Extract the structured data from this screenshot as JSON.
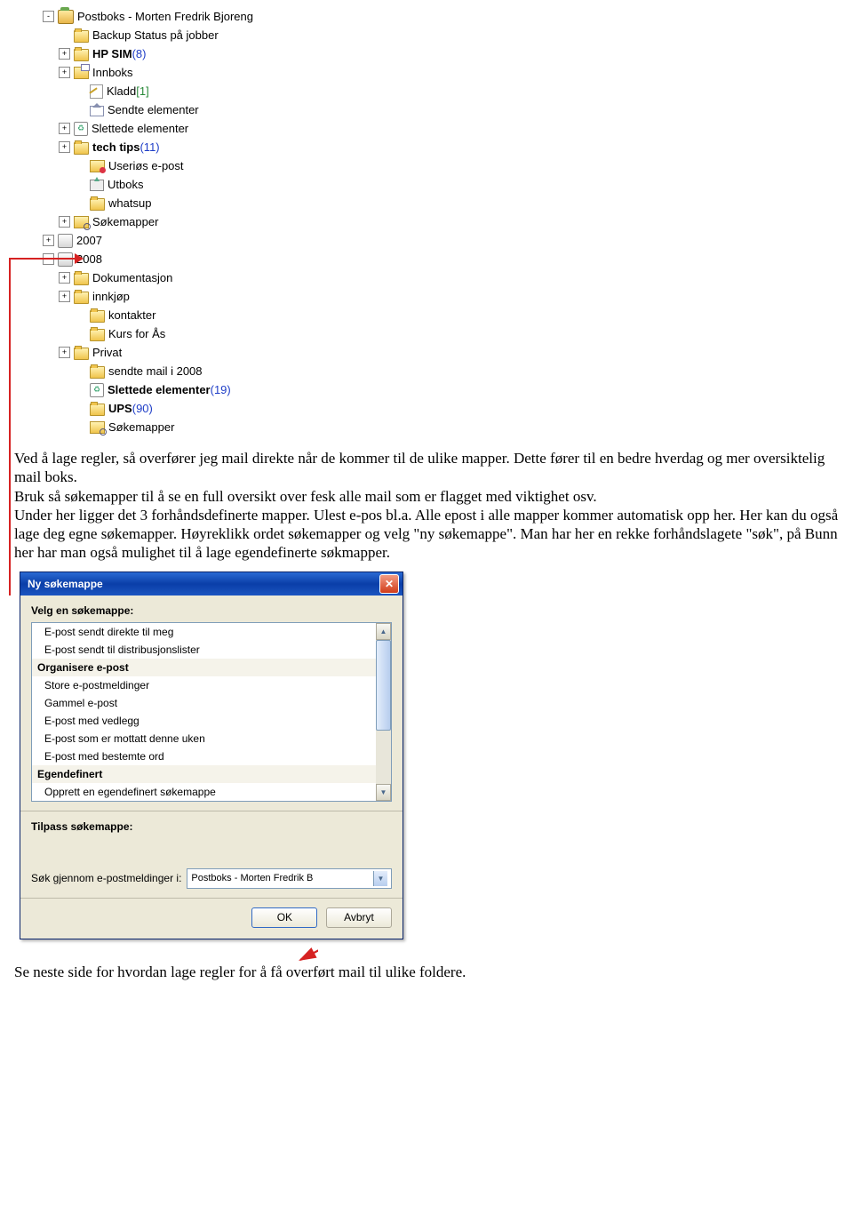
{
  "tree": {
    "root": {
      "label": "Postboks - Morten Fredrik Bjoreng"
    },
    "items1": [
      {
        "label": "Backup Status på jobber",
        "icon": "folder",
        "exp": "",
        "ind": 1
      },
      {
        "label": "HP SIM",
        "count": "(8)",
        "countClass": "count-blue",
        "bold": true,
        "icon": "folder",
        "exp": "+",
        "ind": 1
      },
      {
        "label": "Innboks",
        "icon": "inbox",
        "exp": "+",
        "ind": 1
      },
      {
        "label": "Kladd",
        "count": "[1]",
        "countClass": "count-green",
        "icon": "draft",
        "exp": "",
        "ind": 2
      },
      {
        "label": "Sendte elementer",
        "icon": "sent",
        "exp": "",
        "ind": 2
      },
      {
        "label": "Slettede elementer",
        "icon": "trash",
        "exp": "+",
        "ind": 1
      },
      {
        "label": "tech tips",
        "count": "(11)",
        "countClass": "count-blue",
        "bold": true,
        "icon": "folder",
        "exp": "+",
        "ind": 1
      },
      {
        "label": "Useriøs e-post",
        "icon": "junk",
        "exp": "",
        "ind": 2
      },
      {
        "label": "Utboks",
        "icon": "outbox",
        "exp": "",
        "ind": 2
      },
      {
        "label": "whatsup",
        "icon": "folder",
        "exp": "",
        "ind": 2
      },
      {
        "label": "Søkemapper",
        "icon": "search",
        "exp": "+",
        "ind": 1
      }
    ],
    "store2007": {
      "label": "2007",
      "exp": "+"
    },
    "store2008": {
      "label": "2008",
      "exp": "-"
    },
    "items2008": [
      {
        "label": "Dokumentasjon",
        "icon": "folder",
        "exp": "+",
        "ind": 1
      },
      {
        "label": "innkjøp",
        "icon": "folder",
        "exp": "+",
        "ind": 1
      },
      {
        "label": "kontakter",
        "icon": "folder",
        "exp": "",
        "ind": 2
      },
      {
        "label": "Kurs for Ås",
        "icon": "folder",
        "exp": "",
        "ind": 2
      },
      {
        "label": "Privat",
        "icon": "folder",
        "exp": "+",
        "ind": 1
      },
      {
        "label": "sendte mail i 2008",
        "icon": "folder",
        "exp": "",
        "ind": 2
      },
      {
        "label": "Slettede elementer",
        "count": "(19)",
        "countClass": "count-blue",
        "bold": true,
        "icon": "trash",
        "exp": "",
        "ind": 2
      },
      {
        "label": "UPS",
        "count": "(90)",
        "countClass": "count-blue",
        "bold": true,
        "icon": "folder",
        "exp": "",
        "ind": 2
      },
      {
        "label": "Søkemapper",
        "icon": "search",
        "exp": "",
        "ind": 2
      }
    ]
  },
  "para1": "Ved å lage regler, så overfører jeg mail direkte når de kommer til de ulike mapper. Dette fører til en bedre hverdag og mer oversiktelig mail boks.",
  "para2": "Bruk så søkemapper til å se en full oversikt over fesk alle mail som er flagget med viktighet osv.",
  "para3": "Under her ligger det 3 forhåndsdefinerte mapper. Ulest e-pos bl.a. Alle epost i alle mapper kommer automatisk opp her. Her kan du også lage deg egne søkemapper. Høyreklikk ordet søkemapper og  velg \"ny søkemappe\". Man har her en rekke forhåndslagete \"søk\", på Bunn her har man også mulighet til å lage egendefinerte søkmapper.",
  "dialog": {
    "title": "Ny søkemappe",
    "selectLabel": "Velg en søkemappe:",
    "groups": [
      {
        "header": null,
        "items": [
          "E-post sendt direkte til meg",
          "E-post sendt til distribusjonslister"
        ]
      },
      {
        "header": "Organisere e-post",
        "items": [
          "Store e-postmeldinger",
          "Gammel e-post",
          "E-post med vedlegg",
          "E-post som er mottatt denne uken",
          "E-post med bestemte ord"
        ]
      },
      {
        "header": "Egendefinert",
        "items": [
          "Opprett en egendefinert søkemappe"
        ]
      }
    ],
    "customizeLabel": "Tilpass søkemappe:",
    "searchInLabel": "Søk gjennom e-postmeldinger i:",
    "searchInValue": "Postboks - Morten Fredrik B",
    "okLabel": "OK",
    "cancelLabel": "Avbryt"
  },
  "footer": "Se neste side for hvordan lage regler for å få overført mail til ulike foldere."
}
